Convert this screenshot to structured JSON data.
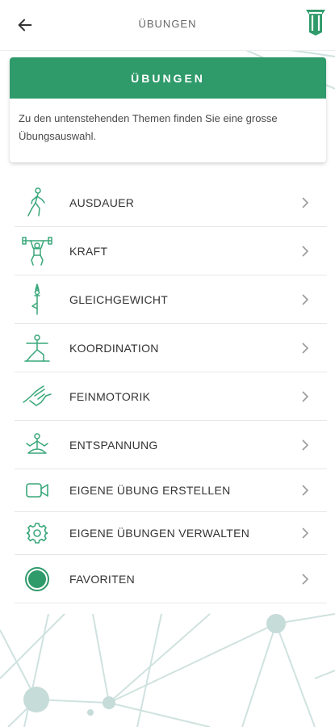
{
  "header": {
    "title": "ÜBUNGEN",
    "back_icon": "arrow-left-icon",
    "logo_icon": "app-logo-icon"
  },
  "card": {
    "title": "ÜBUNGEN",
    "text": "Zu den untenstehenden Themen finden Sie eine grosse Übungsauswahl."
  },
  "menu": {
    "items": [
      {
        "label": "AUSDAUER",
        "icon": "walking-person-icon"
      },
      {
        "label": "KRAFT",
        "icon": "weightlifter-icon"
      },
      {
        "label": "GLEICHGEWICHT",
        "icon": "tree-pose-icon"
      },
      {
        "label": "KOORDINATION",
        "icon": "lunge-pose-icon"
      },
      {
        "label": "FEINMOTORIK",
        "icon": "hand-fine-motor-icon"
      },
      {
        "label": "ENTSPANNUNG",
        "icon": "meditation-icon"
      },
      {
        "label": "EIGENE ÜBUNG ERSTELLEN",
        "icon": "video-camera-icon"
      },
      {
        "label": "EIGENE ÜBUNGEN VERWALTEN",
        "icon": "gear-icon"
      },
      {
        "label": "FAVORITEN",
        "icon": "favorite-circle-icon"
      }
    ]
  },
  "colors": {
    "accent": "#2f9a6a",
    "icon": "#3aa77a",
    "chevron": "#9a9a9a",
    "network": "#c9dedb"
  }
}
